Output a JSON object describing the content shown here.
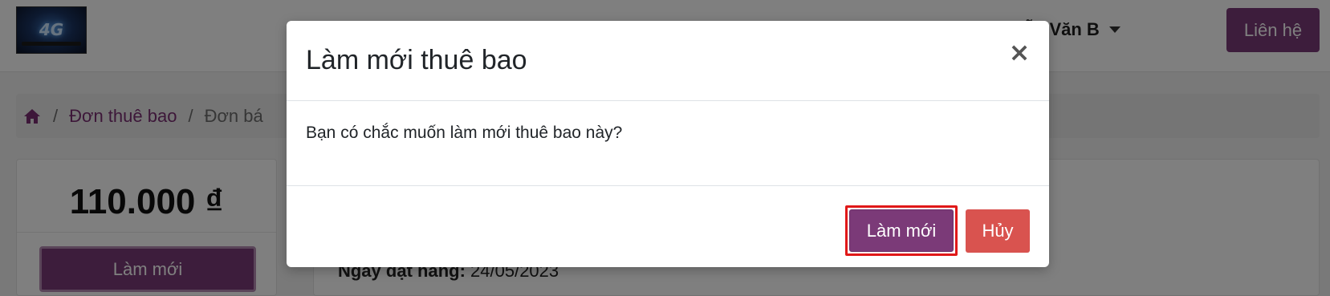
{
  "navbar": {
    "logo_text": "4G",
    "user_name": "uyễn Văn B",
    "contact_label": "Liên hệ"
  },
  "breadcrumb": {
    "items": [
      "Đơn thuê bao",
      "Đơn bá"
    ],
    "separator": "/"
  },
  "price_card": {
    "price": "110.000 ₫",
    "renew_label": "Làm mới"
  },
  "detail_card": {
    "order_date_label": "Ngày đặt hàng:",
    "order_date_value": "24/05/2023"
  },
  "modal": {
    "title": "Làm mới thuê bao",
    "close_symbol": "×",
    "message": "Bạn có chắc muốn làm mới thuê bao này?",
    "confirm_label": "Làm mới",
    "cancel_label": "Hủy"
  },
  "colors": {
    "brand": "#7b3a78",
    "danger": "#d9534f",
    "highlight": "#e01818"
  }
}
